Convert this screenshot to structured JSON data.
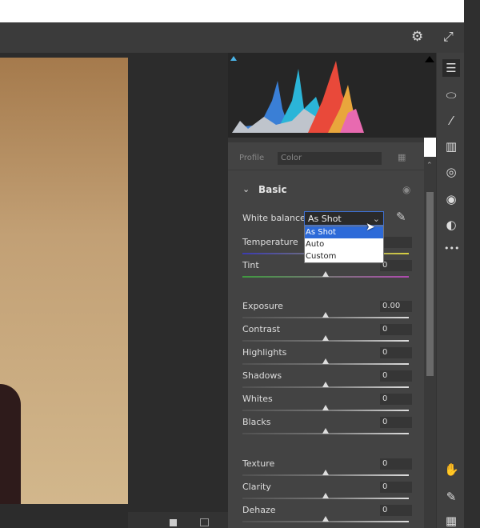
{
  "panel": {
    "profile_label": "Profile",
    "profile_value": "Color",
    "section_title": "Basic",
    "white_balance": {
      "label": "White balance",
      "value": "As Shot",
      "options": [
        "As Shot",
        "Auto",
        "Custom"
      ]
    },
    "sliders": [
      {
        "label": "Temperature",
        "value": ""
      },
      {
        "label": "Tint",
        "value": "0"
      },
      {
        "label": "Exposure",
        "value": "0.00"
      },
      {
        "label": "Contrast",
        "value": "0"
      },
      {
        "label": "Highlights",
        "value": "0"
      },
      {
        "label": "Shadows",
        "value": "0"
      },
      {
        "label": "Whites",
        "value": "0"
      },
      {
        "label": "Blacks",
        "value": "0"
      },
      {
        "label": "Texture",
        "value": "0"
      },
      {
        "label": "Clarity",
        "value": "0"
      },
      {
        "label": "Dehaze",
        "value": "0"
      }
    ]
  },
  "icons": {
    "settings": "gear-icon",
    "fullscreen": "expand-icon",
    "more": "•••"
  }
}
